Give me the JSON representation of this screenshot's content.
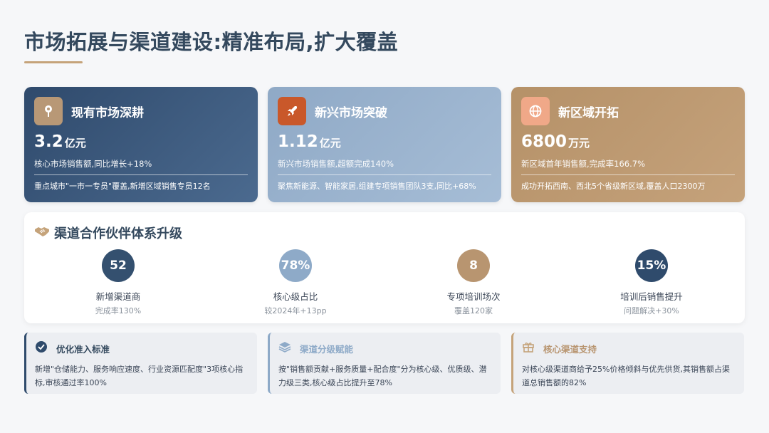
{
  "title": "市场拓展与渠道建设:精准布局,扩大覆盖",
  "colors": {
    "primary": "#2f4b6c",
    "light_blue": "#8eaac8",
    "gold": "#c5a37a",
    "orange": "#c9582a"
  },
  "cards": [
    {
      "icon": "map-pin-icon",
      "title": "现有市场深耕",
      "value": "3.2",
      "unit": "亿元",
      "sub": "核心市场销售额,同比增长+18%",
      "desc": "重点城市\"一市一专员\"覆盖,新增区域销售专员12名"
    },
    {
      "icon": "rocket-icon",
      "title": "新兴市场突破",
      "value": "1.12",
      "unit": "亿元",
      "sub": "新兴市场销售额,超额完成140%",
      "desc": "聚焦新能源、智能家居,组建专项销售团队3支,同比+68%"
    },
    {
      "icon": "globe-icon",
      "title": "新区域开拓",
      "value": "6800",
      "unit": "万元",
      "sub": "新区域首年销售额,完成率166.7%",
      "desc": "成功开拓西南、西北5个省级新区域,覆盖人口2300万"
    }
  ],
  "partner": {
    "icon": "handshake-icon",
    "title": "渠道合作伙伴体系升级",
    "stats": [
      {
        "value": "52",
        "label": "新增渠道商",
        "note": "完成率130%"
      },
      {
        "value": "78%",
        "label": "核心级占比",
        "note": "较2024年+13pp"
      },
      {
        "value": "8",
        "label": "专项培训场次",
        "note": "覆盖120家"
      },
      {
        "value": "15%",
        "label": "培训后销售提升",
        "note": "问题解决+30%"
      }
    ]
  },
  "boxes": [
    {
      "icon": "check-circle-icon",
      "title": "优化准入标准",
      "text": "新增\"仓储能力、服务响应速度、行业资源匹配度\"3项核心指标,审核通过率100%"
    },
    {
      "icon": "layers-icon",
      "title": "渠道分级赋能",
      "text": "按\"销售额贡献+服务质量+配合度\"分为核心级、优质级、潜力级三类,核心级占比提升至78%"
    },
    {
      "icon": "gift-icon",
      "title": "核心渠道支持",
      "text": "对核心级渠道商给予25%价格倾斜与优先供货,其销售额占渠道总销售额的82%"
    }
  ]
}
